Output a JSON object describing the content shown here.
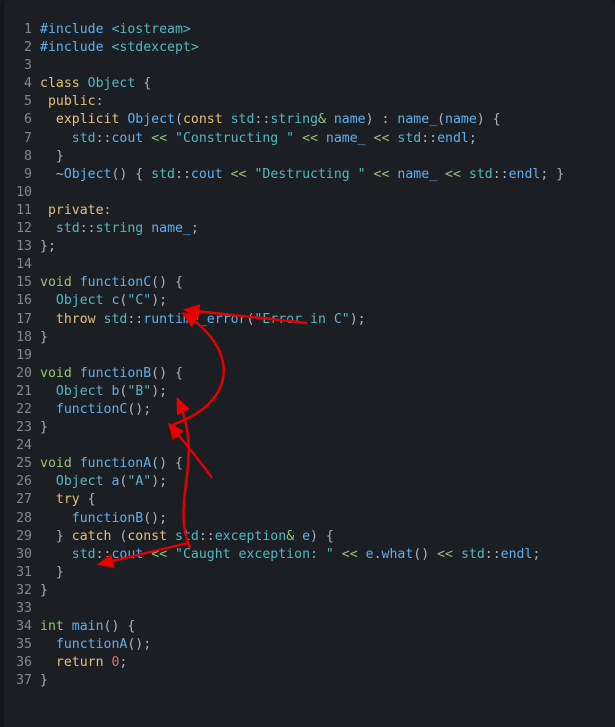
{
  "editor": {
    "language": "cpp",
    "background_color": "#1b1f23",
    "gutter_color": "#7d8a8f",
    "annotation_color": "#e60000",
    "total_lines": 37
  },
  "palette": {
    "keyword": "#e5c07b",
    "type": "#98c379",
    "function": "#61afef",
    "namespace": "#56b6c2",
    "string": "#56b6c2",
    "number": "#e06c75",
    "punctuation": "#abb2bf",
    "operator": "#98c379",
    "plain": "#d7dae0"
  },
  "code": {
    "lines": [
      {
        "num": "1",
        "tokens": [
          {
            "t": "#include ",
            "c": "t-pre"
          },
          {
            "t": "<iostream>",
            "c": "t-str"
          }
        ]
      },
      {
        "num": "2",
        "tokens": [
          {
            "t": "#include ",
            "c": "t-pre"
          },
          {
            "t": "<stdexcept>",
            "c": "t-str"
          }
        ]
      },
      {
        "num": "3",
        "tokens": []
      },
      {
        "num": "4",
        "tokens": [
          {
            "t": "class ",
            "c": "t-kw"
          },
          {
            "t": "Object",
            "c": "t-id"
          },
          {
            "t": " {",
            "c": "t-op"
          }
        ]
      },
      {
        "num": "5",
        "tokens": [
          {
            "t": " ",
            "c": "t-plain"
          },
          {
            "t": "public",
            "c": "t-kw"
          },
          {
            "t": ":",
            "c": "t-op"
          }
        ]
      },
      {
        "num": "6",
        "tokens": [
          {
            "t": "  ",
            "c": "t-plain"
          },
          {
            "t": "explicit ",
            "c": "t-kw"
          },
          {
            "t": "Object",
            "c": "t-fn"
          },
          {
            "t": "(",
            "c": "t-op"
          },
          {
            "t": "const ",
            "c": "t-kw"
          },
          {
            "t": "std",
            "c": "t-id"
          },
          {
            "t": "::",
            "c": "t-op"
          },
          {
            "t": "string",
            "c": "t-id"
          },
          {
            "t": "&",
            "c": "t-shift"
          },
          {
            "t": " name",
            "c": "t-fn"
          },
          {
            "t": ") : ",
            "c": "t-op"
          },
          {
            "t": "name_",
            "c": "t-fn"
          },
          {
            "t": "(",
            "c": "t-op"
          },
          {
            "t": "name",
            "c": "t-fn"
          },
          {
            "t": ") {",
            "c": "t-op"
          }
        ]
      },
      {
        "num": "7",
        "tokens": [
          {
            "t": "    ",
            "c": "t-plain"
          },
          {
            "t": "std",
            "c": "t-id"
          },
          {
            "t": "::",
            "c": "t-op"
          },
          {
            "t": "cout ",
            "c": "t-fn"
          },
          {
            "t": "<<",
            "c": "t-shift"
          },
          {
            "t": " ",
            "c": "t-plain"
          },
          {
            "t": "\"Constructing \"",
            "c": "t-str"
          },
          {
            "t": " ",
            "c": "t-plain"
          },
          {
            "t": "<<",
            "c": "t-shift"
          },
          {
            "t": " name_ ",
            "c": "t-fn"
          },
          {
            "t": "<<",
            "c": "t-shift"
          },
          {
            "t": " ",
            "c": "t-plain"
          },
          {
            "t": "std",
            "c": "t-id"
          },
          {
            "t": "::",
            "c": "t-op"
          },
          {
            "t": "endl",
            "c": "t-fn"
          },
          {
            "t": ";",
            "c": "t-op"
          }
        ]
      },
      {
        "num": "8",
        "tokens": [
          {
            "t": "  }",
            "c": "t-op"
          }
        ]
      },
      {
        "num": "9",
        "tokens": [
          {
            "t": "  ~",
            "c": "t-op"
          },
          {
            "t": "Object",
            "c": "t-fn"
          },
          {
            "t": "() { ",
            "c": "t-op"
          },
          {
            "t": "std",
            "c": "t-id"
          },
          {
            "t": "::",
            "c": "t-op"
          },
          {
            "t": "cout ",
            "c": "t-fn"
          },
          {
            "t": "<<",
            "c": "t-shift"
          },
          {
            "t": " ",
            "c": "t-plain"
          },
          {
            "t": "\"Destructing \"",
            "c": "t-str"
          },
          {
            "t": " ",
            "c": "t-plain"
          },
          {
            "t": "<<",
            "c": "t-shift"
          },
          {
            "t": " name_ ",
            "c": "t-fn"
          },
          {
            "t": "<<",
            "c": "t-shift"
          },
          {
            "t": " ",
            "c": "t-plain"
          },
          {
            "t": "std",
            "c": "t-id"
          },
          {
            "t": "::",
            "c": "t-op"
          },
          {
            "t": "endl",
            "c": "t-fn"
          },
          {
            "t": "; }",
            "c": "t-op"
          }
        ]
      },
      {
        "num": "10",
        "tokens": []
      },
      {
        "num": "11",
        "tokens": [
          {
            "t": " ",
            "c": "t-plain"
          },
          {
            "t": "private",
            "c": "t-kw"
          },
          {
            "t": ":",
            "c": "t-op"
          }
        ]
      },
      {
        "num": "12",
        "tokens": [
          {
            "t": "  ",
            "c": "t-plain"
          },
          {
            "t": "std",
            "c": "t-id"
          },
          {
            "t": "::",
            "c": "t-op"
          },
          {
            "t": "string",
            "c": "t-id"
          },
          {
            "t": " name_",
            "c": "t-fn"
          },
          {
            "t": ";",
            "c": "t-op"
          }
        ]
      },
      {
        "num": "13",
        "tokens": [
          {
            "t": "};",
            "c": "t-op"
          }
        ]
      },
      {
        "num": "14",
        "tokens": []
      },
      {
        "num": "15",
        "tokens": [
          {
            "t": "void ",
            "c": "t-type"
          },
          {
            "t": "functionC",
            "c": "t-fn"
          },
          {
            "t": "() {",
            "c": "t-op"
          }
        ]
      },
      {
        "num": "16",
        "tokens": [
          {
            "t": "  ",
            "c": "t-plain"
          },
          {
            "t": "Object",
            "c": "t-id"
          },
          {
            "t": " c",
            "c": "t-fn"
          },
          {
            "t": "(",
            "c": "t-op"
          },
          {
            "t": "\"C\"",
            "c": "t-str"
          },
          {
            "t": ");",
            "c": "t-op"
          }
        ]
      },
      {
        "num": "17",
        "tokens": [
          {
            "t": "  ",
            "c": "t-plain"
          },
          {
            "t": "throw ",
            "c": "t-kw"
          },
          {
            "t": "std",
            "c": "t-id"
          },
          {
            "t": "::",
            "c": "t-op"
          },
          {
            "t": "runtime_error",
            "c": "t-fn"
          },
          {
            "t": "(",
            "c": "t-op"
          },
          {
            "t": "\"Error in C\"",
            "c": "t-str"
          },
          {
            "t": ");",
            "c": "t-op"
          }
        ]
      },
      {
        "num": "18",
        "tokens": [
          {
            "t": "}",
            "c": "t-op"
          }
        ]
      },
      {
        "num": "19",
        "tokens": []
      },
      {
        "num": "20",
        "tokens": [
          {
            "t": "void ",
            "c": "t-type"
          },
          {
            "t": "functionB",
            "c": "t-fn"
          },
          {
            "t": "() {",
            "c": "t-op"
          }
        ]
      },
      {
        "num": "21",
        "tokens": [
          {
            "t": "  ",
            "c": "t-plain"
          },
          {
            "t": "Object",
            "c": "t-id"
          },
          {
            "t": " b",
            "c": "t-fn"
          },
          {
            "t": "(",
            "c": "t-op"
          },
          {
            "t": "\"B\"",
            "c": "t-str"
          },
          {
            "t": ");",
            "c": "t-op"
          }
        ]
      },
      {
        "num": "22",
        "tokens": [
          {
            "t": "  ",
            "c": "t-plain"
          },
          {
            "t": "functionC",
            "c": "t-fn"
          },
          {
            "t": "();",
            "c": "t-op"
          }
        ]
      },
      {
        "num": "23",
        "tokens": [
          {
            "t": "}",
            "c": "t-op"
          }
        ]
      },
      {
        "num": "24",
        "tokens": []
      },
      {
        "num": "25",
        "tokens": [
          {
            "t": "void ",
            "c": "t-type"
          },
          {
            "t": "functionA",
            "c": "t-fn"
          },
          {
            "t": "() {",
            "c": "t-op"
          }
        ]
      },
      {
        "num": "26",
        "tokens": [
          {
            "t": "  ",
            "c": "t-plain"
          },
          {
            "t": "Object",
            "c": "t-id"
          },
          {
            "t": " a",
            "c": "t-fn"
          },
          {
            "t": "(",
            "c": "t-op"
          },
          {
            "t": "\"A\"",
            "c": "t-str"
          },
          {
            "t": ");",
            "c": "t-op"
          }
        ]
      },
      {
        "num": "27",
        "tokens": [
          {
            "t": "  ",
            "c": "t-plain"
          },
          {
            "t": "try",
            "c": "t-kw"
          },
          {
            "t": " {",
            "c": "t-op"
          }
        ]
      },
      {
        "num": "28",
        "tokens": [
          {
            "t": "    ",
            "c": "t-plain"
          },
          {
            "t": "functionB",
            "c": "t-fn"
          },
          {
            "t": "();",
            "c": "t-op"
          }
        ]
      },
      {
        "num": "29",
        "tokens": [
          {
            "t": "  } ",
            "c": "t-op"
          },
          {
            "t": "catch ",
            "c": "t-kw"
          },
          {
            "t": "(",
            "c": "t-op"
          },
          {
            "t": "const ",
            "c": "t-kw"
          },
          {
            "t": "std",
            "c": "t-id"
          },
          {
            "t": "::",
            "c": "t-op"
          },
          {
            "t": "exception",
            "c": "t-id"
          },
          {
            "t": "&",
            "c": "t-shift"
          },
          {
            "t": " e",
            "c": "t-fn"
          },
          {
            "t": ") {",
            "c": "t-op"
          }
        ]
      },
      {
        "num": "30",
        "tokens": [
          {
            "t": "    ",
            "c": "t-plain"
          },
          {
            "t": "std",
            "c": "t-id"
          },
          {
            "t": "::",
            "c": "t-op"
          },
          {
            "t": "cout ",
            "c": "t-fn"
          },
          {
            "t": "<<",
            "c": "t-shift"
          },
          {
            "t": " ",
            "c": "t-plain"
          },
          {
            "t": "\"Caught exception: \"",
            "c": "t-str"
          },
          {
            "t": " ",
            "c": "t-plain"
          },
          {
            "t": "<<",
            "c": "t-shift"
          },
          {
            "t": " e",
            "c": "t-fn"
          },
          {
            "t": ".",
            "c": "t-op"
          },
          {
            "t": "what",
            "c": "t-fn"
          },
          {
            "t": "() ",
            "c": "t-op"
          },
          {
            "t": "<<",
            "c": "t-shift"
          },
          {
            "t": " ",
            "c": "t-plain"
          },
          {
            "t": "std",
            "c": "t-id"
          },
          {
            "t": "::",
            "c": "t-op"
          },
          {
            "t": "endl",
            "c": "t-fn"
          },
          {
            "t": ";",
            "c": "t-op"
          }
        ]
      },
      {
        "num": "31",
        "tokens": [
          {
            "t": "  }",
            "c": "t-op"
          }
        ]
      },
      {
        "num": "32",
        "tokens": [
          {
            "t": "}",
            "c": "t-op"
          }
        ]
      },
      {
        "num": "33",
        "tokens": []
      },
      {
        "num": "34",
        "tokens": [
          {
            "t": "int ",
            "c": "t-type"
          },
          {
            "t": "main",
            "c": "t-fn"
          },
          {
            "t": "() {",
            "c": "t-op"
          }
        ]
      },
      {
        "num": "35",
        "tokens": [
          {
            "t": "  ",
            "c": "t-plain"
          },
          {
            "t": "functionA",
            "c": "t-fn"
          },
          {
            "t": "();",
            "c": "t-op"
          }
        ]
      },
      {
        "num": "36",
        "tokens": [
          {
            "t": "  ",
            "c": "t-plain"
          },
          {
            "t": "return ",
            "c": "t-kw"
          },
          {
            "t": "0",
            "c": "t-num"
          },
          {
            "t": ";",
            "c": "t-op"
          }
        ]
      },
      {
        "num": "37",
        "tokens": [
          {
            "t": "}",
            "c": "t-op"
          }
        ]
      }
    ]
  },
  "annotations": {
    "color": "#e60000",
    "arrows": [
      {
        "name": "throw-to-object-c",
        "from_line": "17",
        "to_line": "16",
        "shape": "straight"
      },
      {
        "name": "functionc-call-to-object-c",
        "from_line": "22",
        "to_line": "16",
        "shape": "curved"
      },
      {
        "name": "functionb-call-to-object-b",
        "from_line": "28",
        "to_line": "21",
        "shape": "curved"
      },
      {
        "name": "catch-to-functionb-call",
        "from_line": "29",
        "to_line": "28",
        "shape": "straight"
      }
    ]
  }
}
